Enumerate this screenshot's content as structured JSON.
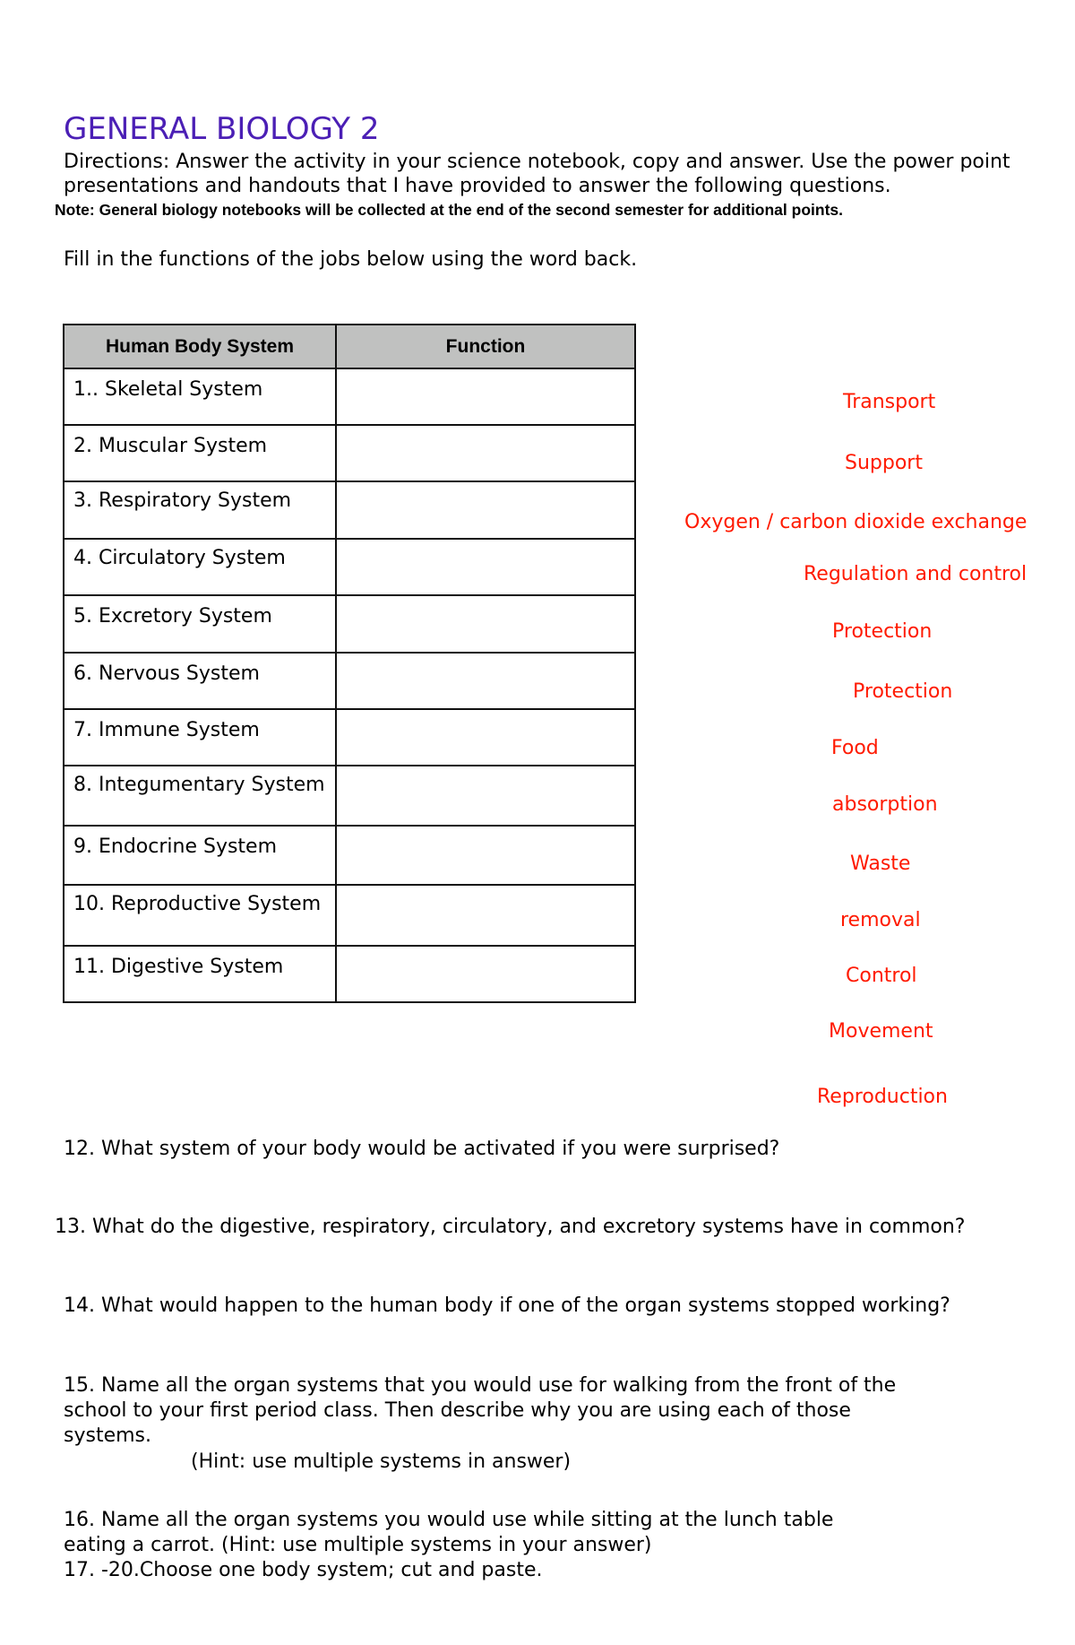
{
  "header": {
    "title": "GENERAL BIOLOGY 2",
    "directions": "Directions: Answer the activity in your science notebook, copy and answer. Use the power point presentations and handouts that I have provided to answer the following questions.",
    "note": "Note: General biology notebooks will be collected at the end of the second semester for additional points.",
    "instruction": "Fill in the functions of the jobs below using the word back."
  },
  "colors": {
    "title": "#4b1fb5",
    "word_bank": "#ff1a00",
    "table_header_bg": "#c0c1c0"
  },
  "table": {
    "columns": [
      "Human Body System",
      "Function"
    ],
    "rows": [
      {
        "system": "1.. Skeletal System",
        "function": ""
      },
      {
        "system": "2. Muscular System",
        "function": ""
      },
      {
        "system": "3. Respiratory System",
        "function": ""
      },
      {
        "system": "4. Circulatory System",
        "function": ""
      },
      {
        "system": "5. Excretory System",
        "function": ""
      },
      {
        "system": "6. Nervous System",
        "function": ""
      },
      {
        "system": "7. Immune System",
        "function": ""
      },
      {
        "system": "8. Integumentary System",
        "function": ""
      },
      {
        "system": "9. Endocrine System",
        "function": ""
      },
      {
        "system": "10. Reproductive System",
        "function": ""
      },
      {
        "system": "11. Digestive System",
        "function": ""
      }
    ]
  },
  "word_bank": [
    "Transport",
    "Support",
    "Oxygen / carbon dioxide exchange",
    "Regulation and control",
    "Protection",
    "Protection",
    "Food",
    "absorption",
    "Waste",
    "removal",
    "Control",
    "Movement",
    "Reproduction"
  ],
  "questions": {
    "q12": "12. What system of your body would be activated if you were surprised?",
    "q13": "13. What do the digestive, respiratory, circulatory, and excretory systems have in common?",
    "q14": "14. What would happen to the human body if one of the organ systems stopped working?",
    "q15": "15. Name all the organ systems that you would use for walking from the front of the\nschool to your first period class. Then describe why you are using each of those\nsystems.",
    "q15_hint": "(Hint: use multiple systems in answer)",
    "q16": "16. Name all the organ systems you would use while sitting at the lunch table\neating a carrot. (Hint: use multiple systems in your answer)",
    "q17": "17. -20.Choose one body system; cut and paste."
  }
}
